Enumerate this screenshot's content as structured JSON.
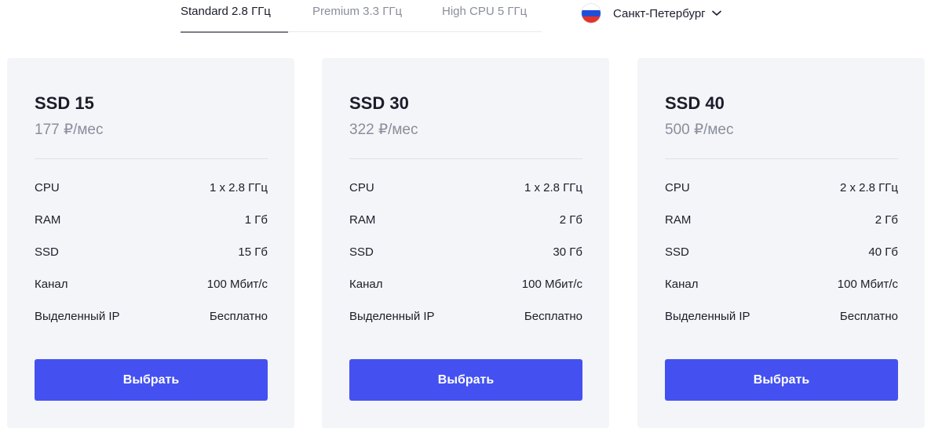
{
  "tabs": [
    {
      "label": "Standard 2.8 ГГц",
      "active": true
    },
    {
      "label": "Premium 3.3 ГГц",
      "active": false
    },
    {
      "label": "High CPU 5 ГГц",
      "active": false
    }
  ],
  "region": {
    "label": "Санкт-Петербург",
    "flag_colors": [
      "#ffffff",
      "#1f4fd8",
      "#e5332a"
    ]
  },
  "colors": {
    "accent": "#4451f0",
    "card_bg": "#f4f5f8",
    "muted_text": "#8a8d9c"
  },
  "plans": [
    {
      "name": "SSD 15",
      "price": "177 ₽/мес",
      "specs": [
        {
          "label": "CPU",
          "value": "1 x 2.8 ГГц"
        },
        {
          "label": "RAM",
          "value": "1 Гб"
        },
        {
          "label": "SSD",
          "value": "15 Гб"
        },
        {
          "label": "Канал",
          "value": "100 Мбит/с"
        },
        {
          "label": "Выделенный IP",
          "value": "Бесплатно"
        }
      ],
      "button": "Выбрать"
    },
    {
      "name": "SSD 30",
      "price": "322 ₽/мес",
      "specs": [
        {
          "label": "CPU",
          "value": "1 x 2.8 ГГц"
        },
        {
          "label": "RAM",
          "value": "2 Гб"
        },
        {
          "label": "SSD",
          "value": "30 Гб"
        },
        {
          "label": "Канал",
          "value": "100 Мбит/с"
        },
        {
          "label": "Выделенный IP",
          "value": "Бесплатно"
        }
      ],
      "button": "Выбрать"
    },
    {
      "name": "SSD 40",
      "price": "500 ₽/мес",
      "specs": [
        {
          "label": "CPU",
          "value": "2 x 2.8 ГГц"
        },
        {
          "label": "RAM",
          "value": "2 Гб"
        },
        {
          "label": "SSD",
          "value": "40 Гб"
        },
        {
          "label": "Канал",
          "value": "100 Мбит/с"
        },
        {
          "label": "Выделенный IP",
          "value": "Бесплатно"
        }
      ],
      "button": "Выбрать"
    }
  ]
}
